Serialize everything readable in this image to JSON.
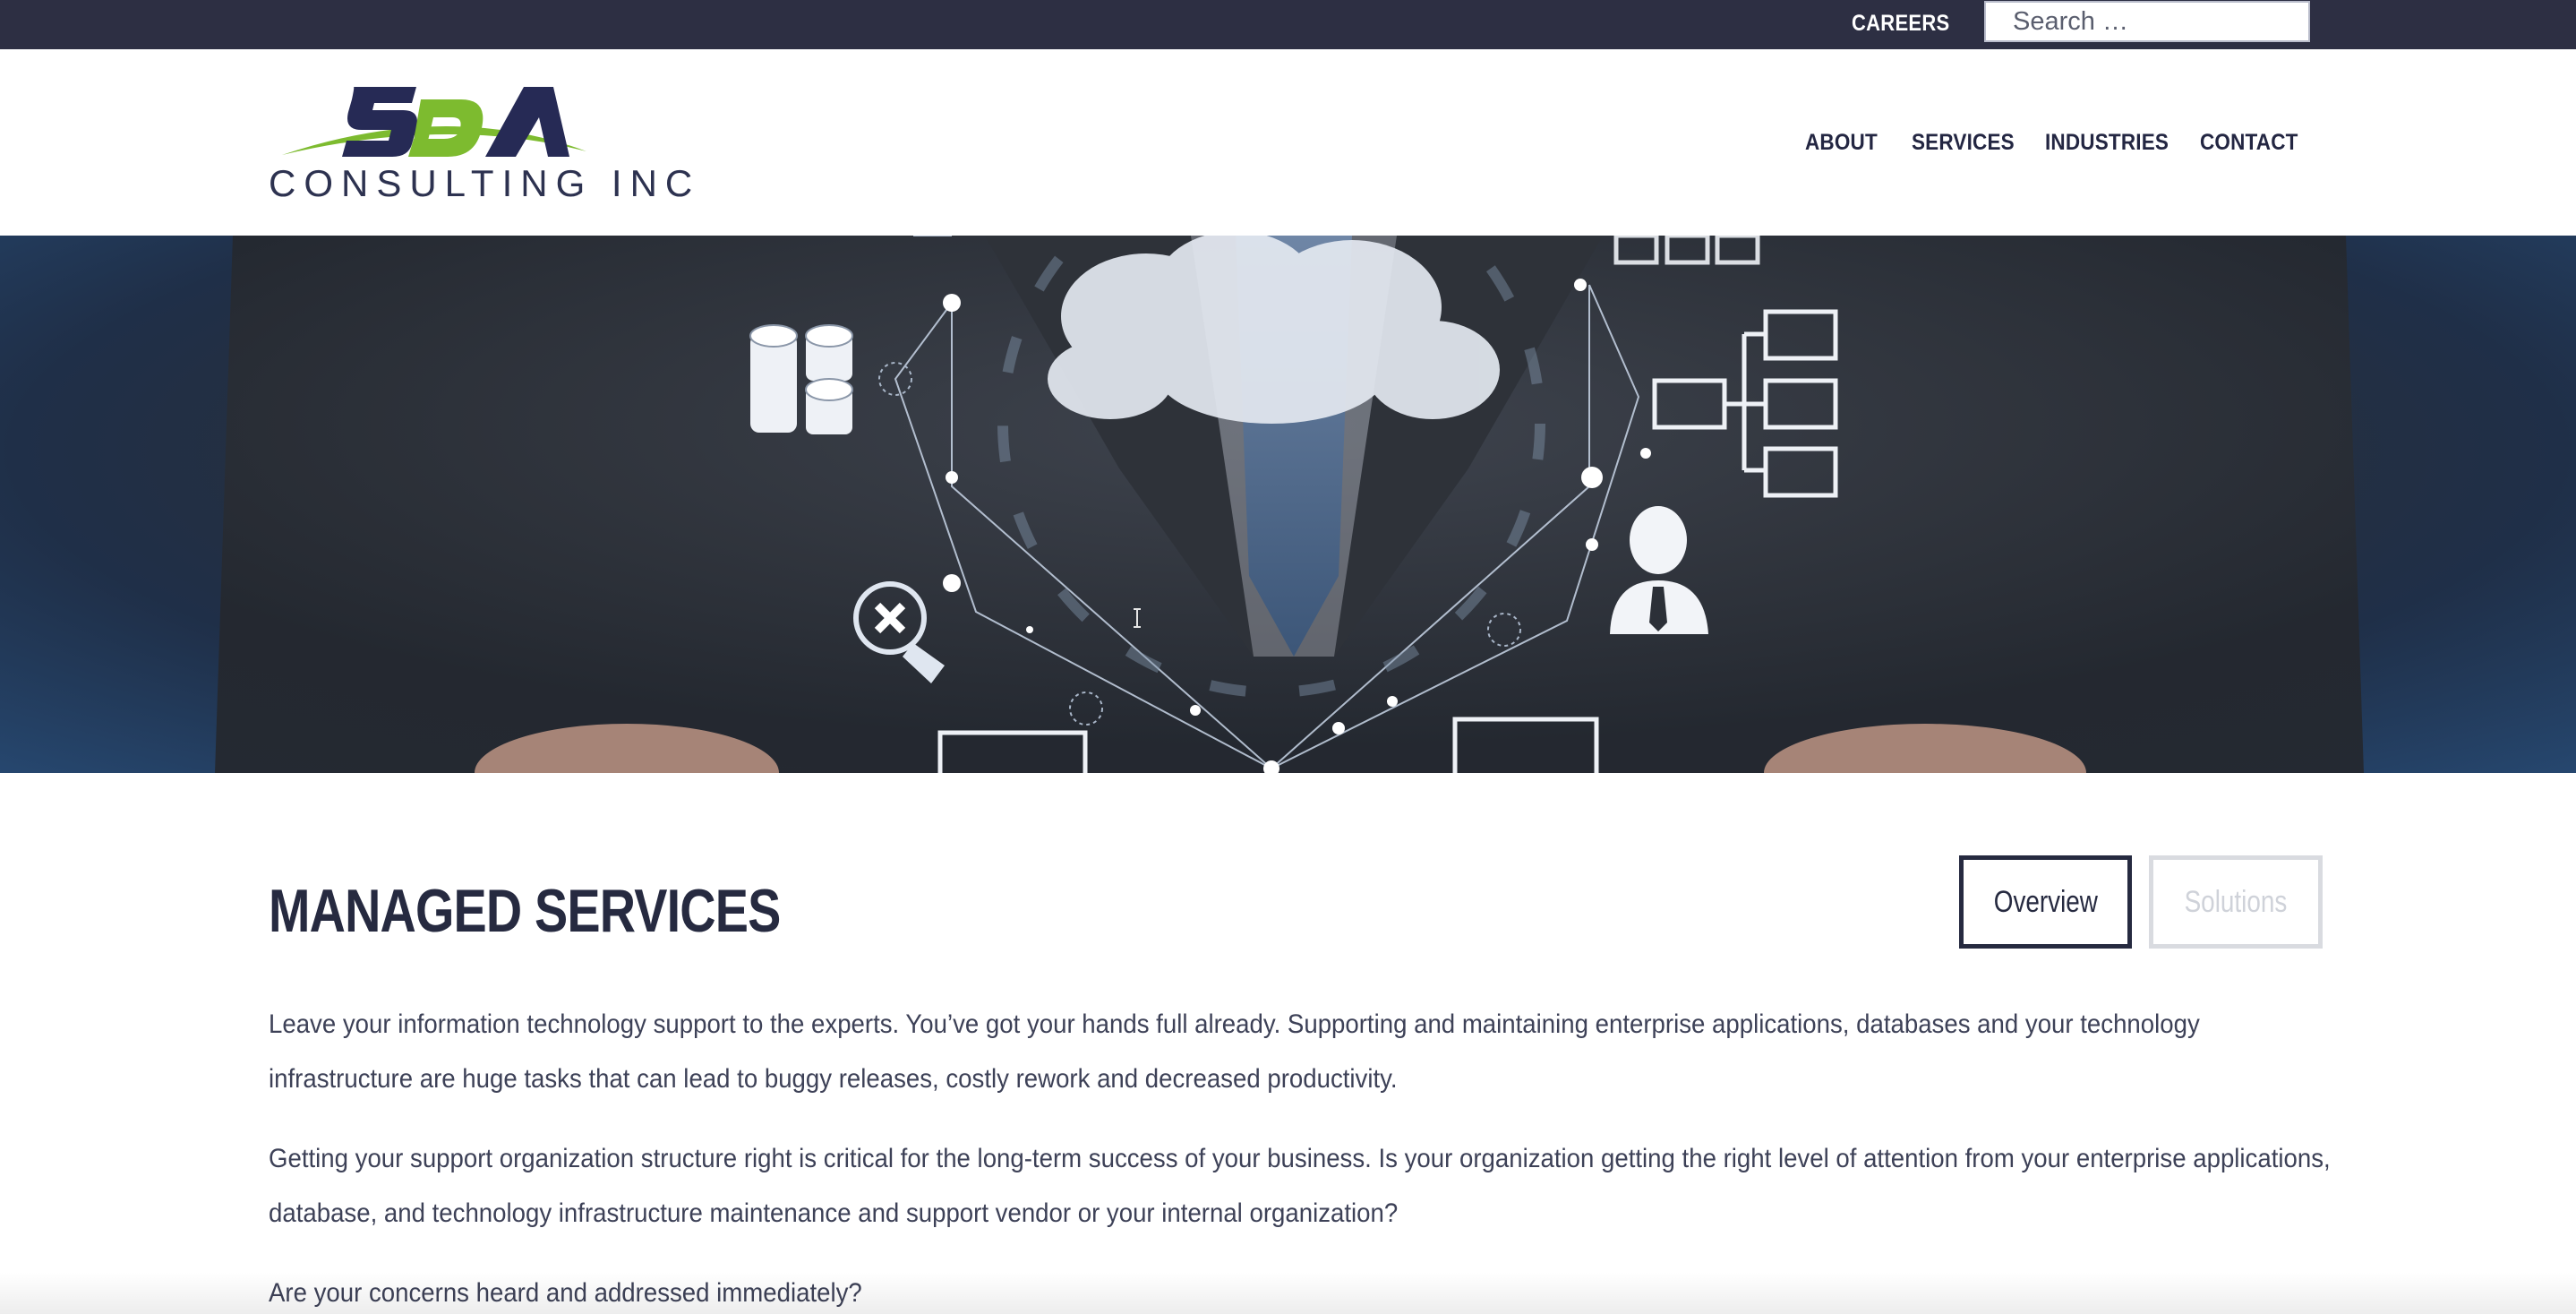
{
  "topbar": {
    "careers_label": "CAREERS",
    "search_placeholder": "Search …"
  },
  "header": {
    "logo_mark": "SDA",
    "logo_text": "CONSULTING INC",
    "nav": [
      "ABOUT",
      "SERVICES",
      "INDUSTRIES",
      "CONTACT"
    ]
  },
  "colors": {
    "topbar_bg": "#2d2f43",
    "brand_navy": "#262a40",
    "brand_green": "#7dbb2f",
    "body_text": "#3d4157",
    "inactive_tab": "#d9dbe0"
  },
  "main": {
    "title": "MANAGED SERVICES",
    "tabs": [
      {
        "label": "Overview",
        "active": true
      },
      {
        "label": "Solutions",
        "active": false
      }
    ],
    "paragraphs": [
      "Leave your information technology support to the experts.  You’ve got your hands full already.  Supporting and maintaining enterprise applications, databases and your technology infrastructure are huge tasks that can lead to buggy releases, costly rework and decreased productivity.",
      "Getting your support organization structure right is critical for the long-term success of your business. Is your organization getting the right level of attention from your enterprise applications, database, and technology infrastructure maintenance and support vendor or your internal organization?",
      "Are your concerns heard and addressed immediately?"
    ]
  },
  "hero": {
    "icons": [
      "cloud-icon",
      "database-icon",
      "network-icon",
      "user-icon",
      "search-x-icon",
      "monitor-icon"
    ]
  }
}
